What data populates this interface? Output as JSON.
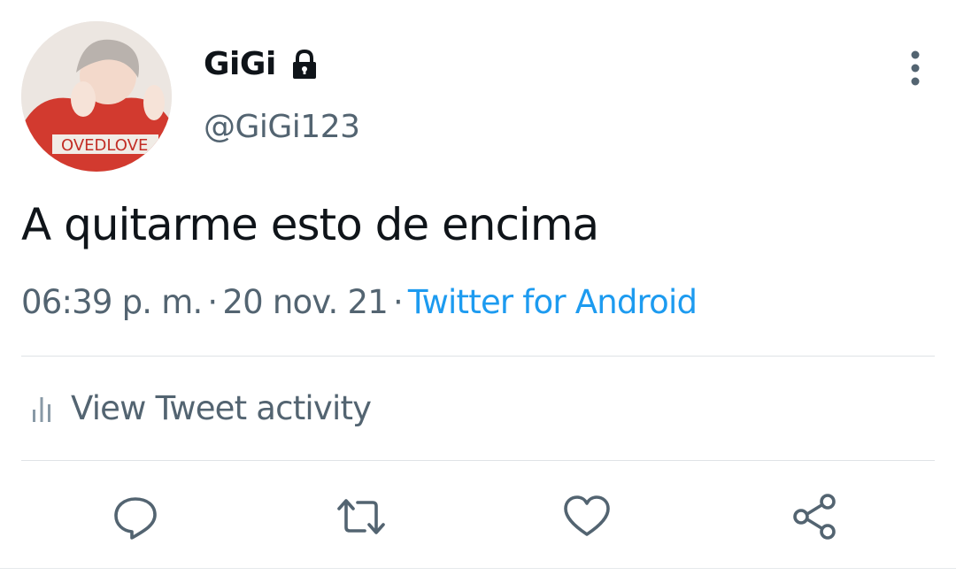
{
  "tweet": {
    "display_name": "GiGi",
    "handle": "@GiGi123",
    "text": "A quitarme esto de encima",
    "time": "06:39 p. m.",
    "date": "20 nov. 21",
    "separator": "·",
    "source": "Twitter for Android",
    "protected": true
  },
  "activity": {
    "label": "View Tweet activity",
    "icon": "bar-chart-icon"
  },
  "actions": [
    {
      "name": "reply",
      "icon": "reply-icon"
    },
    {
      "name": "retweet",
      "icon": "retweet-icon"
    },
    {
      "name": "like",
      "icon": "heart-icon"
    },
    {
      "name": "share",
      "icon": "share-icon"
    }
  ],
  "colors": {
    "text": "#0f1419",
    "secondary": "#536471",
    "link": "#1d9bf0",
    "divider": "#dfe3e6"
  }
}
